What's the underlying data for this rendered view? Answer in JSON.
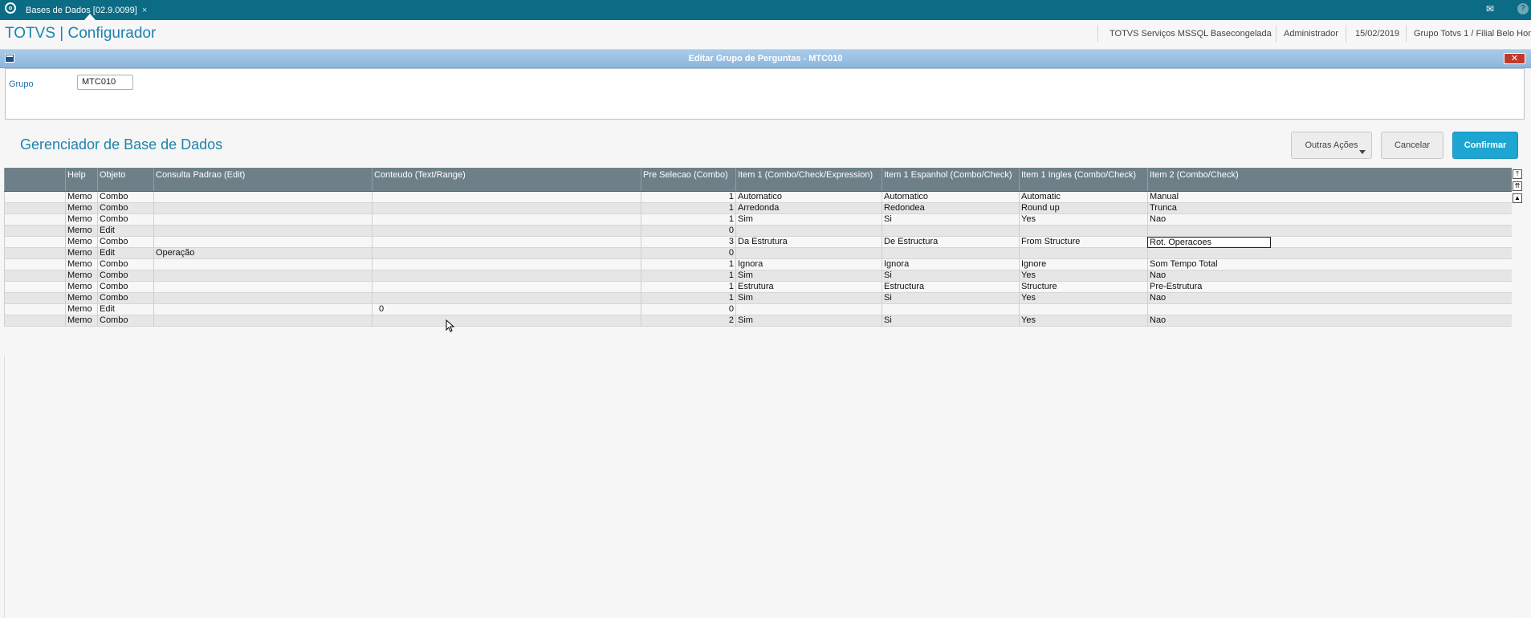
{
  "topbar": {
    "tab_label": "Bases de Dados [02.9.0099]",
    "tab_close": "×",
    "mail_icon": "mail-icon",
    "help_icon": "help-icon"
  },
  "header": {
    "app_title": "TOTVS | Configurador",
    "environment": "TOTVS Serviços MSSQL Basecongelada",
    "user": "Administrador",
    "date": "15/02/2019",
    "branch": "Grupo Totvs 1 / Filial Belo Hor"
  },
  "dialog": {
    "title": "Editar Grupo de Perguntas - MTC010",
    "close_label": "✕"
  },
  "grupo": {
    "label": "Grupo",
    "value": "MTC010"
  },
  "manager": {
    "title": "Gerenciador de Base de Dados",
    "outras_acoes": "Outras Ações",
    "cancelar": "Cancelar",
    "confirmar": "Confirmar"
  },
  "grid": {
    "columns": [
      "",
      "Help",
      "Objeto",
      "Consulta Padrao (Edit)",
      "Conteudo (Text/Range)",
      "Pre Selecao (Combo)",
      "Item 1 (Combo/Check/Expression)",
      "Item 1 Espanhol (Combo/Check)",
      "Item 1 Ingles (Combo/Check)",
      "Item 2 (Combo/Check)"
    ],
    "rows": [
      [
        "",
        "Memo",
        "Combo",
        "",
        "",
        "1",
        "Automatico",
        "Automatico",
        "Automatic",
        "Manual"
      ],
      [
        "",
        "Memo",
        "Combo",
        "",
        "",
        "1",
        "Arredonda",
        "Redondea",
        "Round up",
        "Trunca"
      ],
      [
        "",
        "Memo",
        "Combo",
        "",
        "",
        "1",
        "Sim",
        "Si",
        "Yes",
        "Nao"
      ],
      [
        "",
        "Memo",
        "Edit",
        "",
        "",
        "0",
        "",
        "",
        "",
        ""
      ],
      [
        "",
        "Memo",
        "Combo",
        "",
        "",
        "3",
        "Da Estrutura",
        "De Estructura",
        "From Structure",
        "Rot.  Operacoes"
      ],
      [
        "",
        "Memo",
        "Edit",
        "Operação",
        "",
        "0",
        "",
        "",
        "",
        ""
      ],
      [
        "",
        "Memo",
        "Combo",
        "",
        "",
        "1",
        "Ignora",
        "Ignora",
        "Ignore",
        "Som Tempo Total"
      ],
      [
        "",
        "Memo",
        "Combo",
        "",
        "",
        "1",
        "Sim",
        "Si",
        "Yes",
        "Nao"
      ],
      [
        "",
        "Memo",
        "Combo",
        "",
        "",
        "1",
        "Estrutura",
        "Estructura",
        "Structure",
        "Pre-Estrutura"
      ],
      [
        "",
        "Memo",
        "Combo",
        "",
        "",
        "1",
        "Sim",
        "Si",
        "Yes",
        "Nao"
      ],
      [
        "",
        "Memo",
        "Edit",
        "",
        "0",
        "0",
        "",
        "",
        "",
        ""
      ],
      [
        "",
        "Memo",
        "Combo",
        "",
        "",
        "2",
        "Sim",
        "Si",
        "Yes",
        "Nao"
      ]
    ],
    "selected_cell": {
      "row": 4,
      "col": 9
    }
  }
}
